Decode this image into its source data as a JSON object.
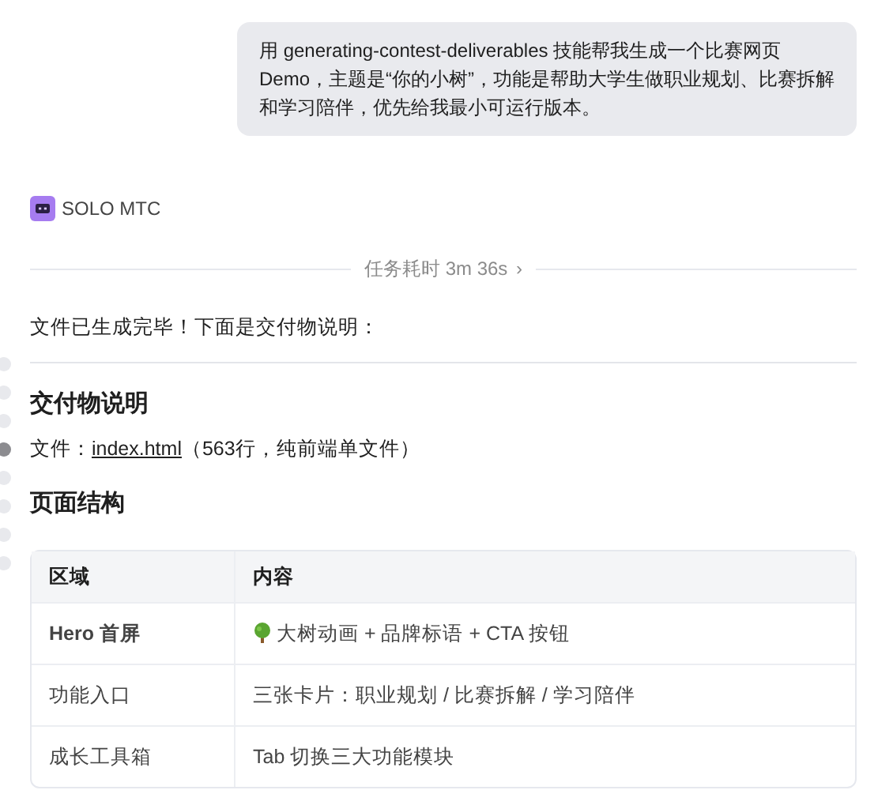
{
  "user_message": "用 generating-contest-deliverables 技能帮我生成一个比赛网页Demo，主题是“你的小树”，功能是帮助大学生做职业规划、比赛拆解和学习陪伴，优先给我最小可运行版本。",
  "assistant": {
    "name": "SOLO MTC"
  },
  "duration": {
    "label": "任务耗时 3m 36s",
    "chevron": "›"
  },
  "intro": "文件已生成完毕！下面是交付物说明：",
  "sections": [
    {
      "heading": "交付物说明",
      "file_label": "文件：",
      "file_link": "index.html",
      "file_note": "（563行，纯前端单文件）"
    },
    {
      "heading": "页面结构"
    }
  ],
  "outline_dots": [
    {
      "selected": false
    },
    {
      "selected": false
    },
    {
      "selected": false
    },
    {
      "selected": true
    },
    {
      "selected": false
    },
    {
      "selected": false
    },
    {
      "selected": false
    },
    {
      "selected": false
    }
  ],
  "table": {
    "columns": [
      "区域",
      "内容"
    ],
    "rows": [
      {
        "area": "Hero 首屏",
        "strong": true,
        "kind": "with_icon",
        "content": "大树动画 + 品牌标语 + CTA 按钮"
      },
      {
        "area": "功能入口",
        "strong": false,
        "kind": "plain",
        "content": "三张卡片：职业规划 / 比赛拆解 / 学习陪伴"
      },
      {
        "area": "成长工具箱",
        "strong": false,
        "kind": "plain",
        "content": "Tab 切换三大功能模块"
      }
    ]
  }
}
